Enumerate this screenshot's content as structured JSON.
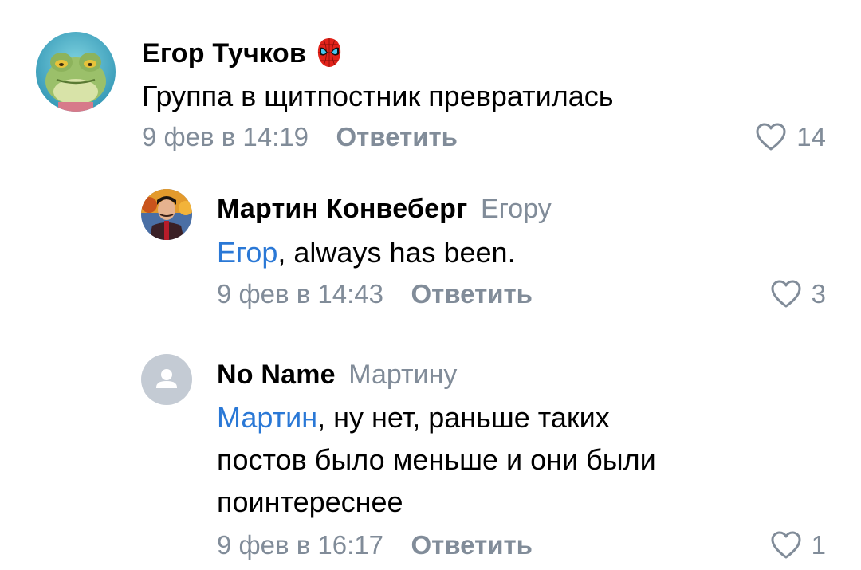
{
  "comments": [
    {
      "author": "Егор Тучков",
      "author_emoji": "spider-man-mask",
      "reply_to": "",
      "mention": "",
      "text": "Группа в щитпостник превратилась",
      "text_lines": [],
      "timestamp": "9 фев в 14:19",
      "reply_label": "Ответить",
      "likes": "14"
    },
    {
      "author": "Мартин Конвеберг",
      "reply_to": "Егору",
      "mention": "Егор",
      "text": ", always has been.",
      "text_lines": [],
      "timestamp": "9 фев в 14:43",
      "reply_label": "Ответить",
      "likes": "3"
    },
    {
      "author": "No Name",
      "reply_to": "Мартину",
      "mention": "Мартин",
      "text": ", ну нет, раньше таких",
      "text_lines": [
        "постов было меньше и они были",
        "поинтереснее"
      ],
      "timestamp": "9 фев в 16:17",
      "reply_label": "Ответить",
      "likes": "1"
    }
  ],
  "colors": {
    "secondary_text": "#818c99",
    "mention": "#2a78d6",
    "default_avatar_bg": "#c4cbd4",
    "default_avatar_icon": "#ffffff"
  },
  "icons": {
    "like": "heart-outline-icon",
    "default_avatar": "user-silhouette-icon"
  }
}
